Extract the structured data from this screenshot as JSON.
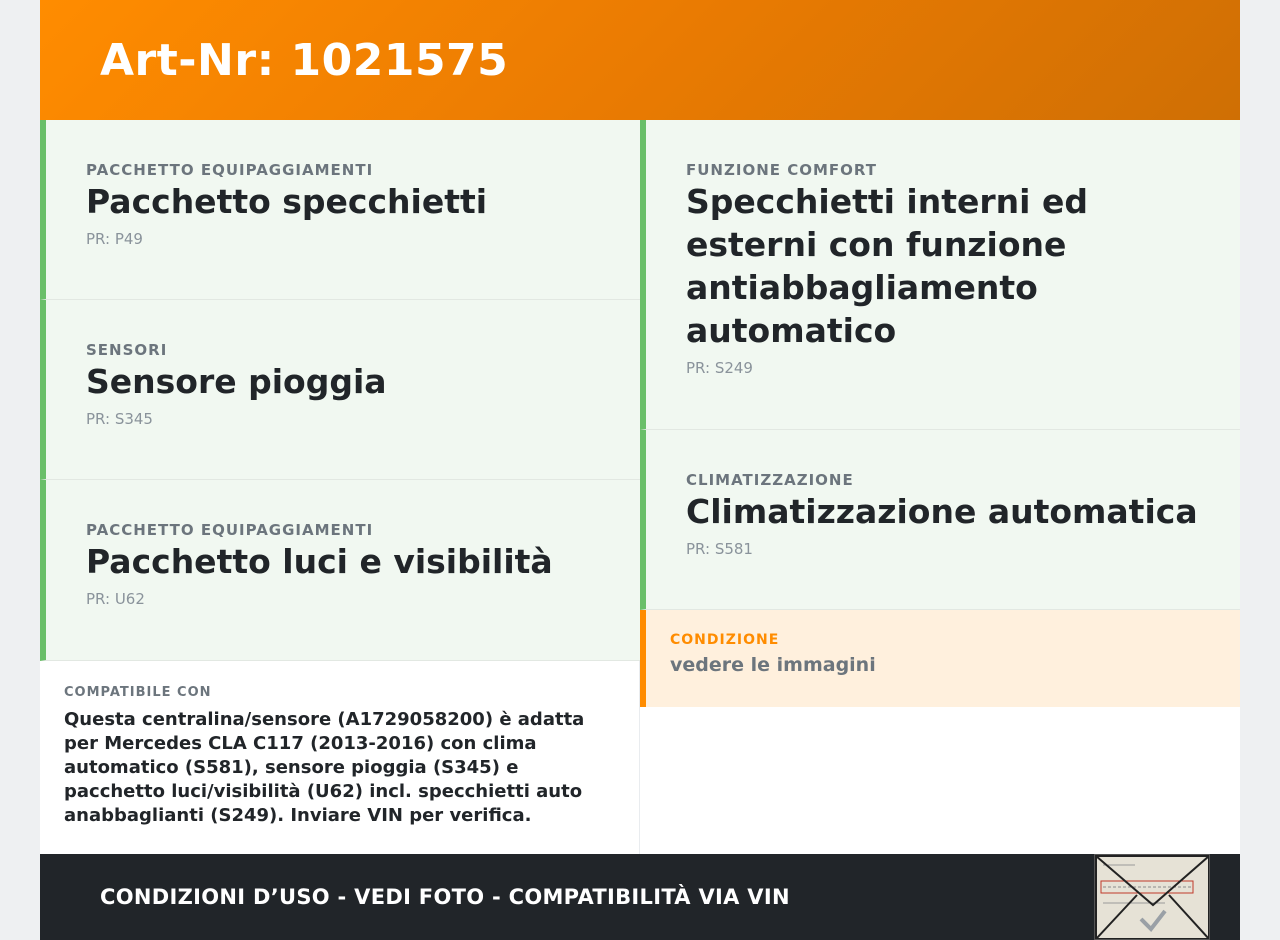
{
  "header": {
    "title": "Art-Nr: 1021575"
  },
  "left_cards": [
    {
      "category": "PACCHETTO EQUIPAGGIAMENTI",
      "title": "Pacchetto specchietti",
      "pr": "PR: P49"
    },
    {
      "category": "SENSORI",
      "title": "Sensore pioggia",
      "pr": "PR: S345"
    },
    {
      "category": "PACCHETTO EQUIPAGGIAMENTI",
      "title": "Pacchetto luci e visibilità",
      "pr": "PR: U62"
    }
  ],
  "right_cards": [
    {
      "category": "FUNZIONE COMFORT",
      "title": "Specchietti interni ed esterni con funzione antiabbagliamento automatico",
      "pr": "PR: S249"
    },
    {
      "category": "CLIMATIZZAZIONE",
      "title": "Climatizzazione automatica",
      "pr": "PR: S581"
    }
  ],
  "condition": {
    "label": "CONDIZIONE",
    "value": "vedere le immagini"
  },
  "compatibility": {
    "label": "COMPATIBILE CON",
    "text": "Questa centralina/sensore (A1729058200) è adatta per Mercedes CLA C117 (2013-2016) con clima automatico (S581), sensore pioggia (S345) e pacchetto luci/visibilità (U62) incl. specchietti auto anabbaglianti (S249). Inviare VIN per verifica."
  },
  "footer": {
    "text": "CONDIZIONI D’USO - VEDI FOTO - COMPATIBILITÀ VIA VIN"
  },
  "thumbnail": {
    "icon": "envelope-icon"
  },
  "colors": {
    "accent": "#ff8c00",
    "green": "#6abf69",
    "dark": "#212529"
  }
}
